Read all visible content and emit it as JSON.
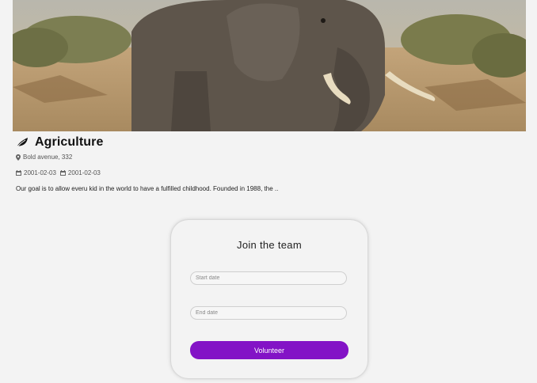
{
  "event": {
    "title": "Agriculture",
    "address": "Bold avenue, 332",
    "start_date": "2001-02-03",
    "end_date": "2001-02-03",
    "description": "Our goal is to allow everu kid in the world to have a fulfilled childhood. Founded in 1988, the .."
  },
  "join": {
    "heading": "Join the team",
    "start_placeholder": "Start date",
    "end_placeholder": "End date",
    "button_label": "Volunteer"
  },
  "icons": {
    "title": "leaf-icon",
    "address": "map-marker-icon",
    "dates": "calendar-icon"
  },
  "colors": {
    "accent": "#8313c6",
    "background": "#f3f3f3"
  }
}
